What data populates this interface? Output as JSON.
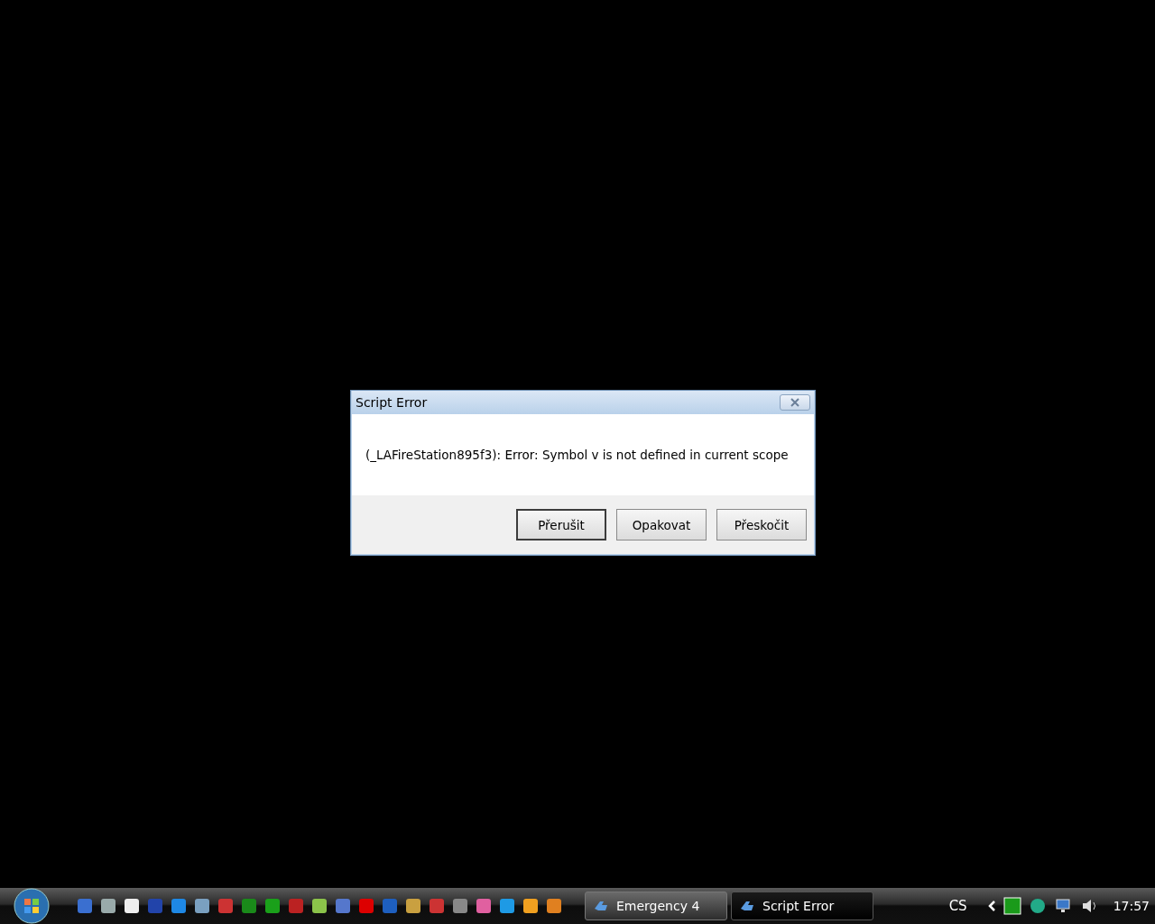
{
  "dialog": {
    "title": "Script Error",
    "message": "(_LAFireStation895f3): Error: Symbol v is not defined in current scope",
    "buttons": [
      {
        "label": "Přerušit",
        "default": true
      },
      {
        "label": "Opakovat",
        "default": false
      },
      {
        "label": "Přeskočit",
        "default": false
      }
    ]
  },
  "taskbar": {
    "tasks": [
      {
        "label": "Emergency 4",
        "selected": false
      },
      {
        "label": "Script Error",
        "selected": true
      }
    ],
    "language": "CS",
    "clock": "17:57"
  }
}
